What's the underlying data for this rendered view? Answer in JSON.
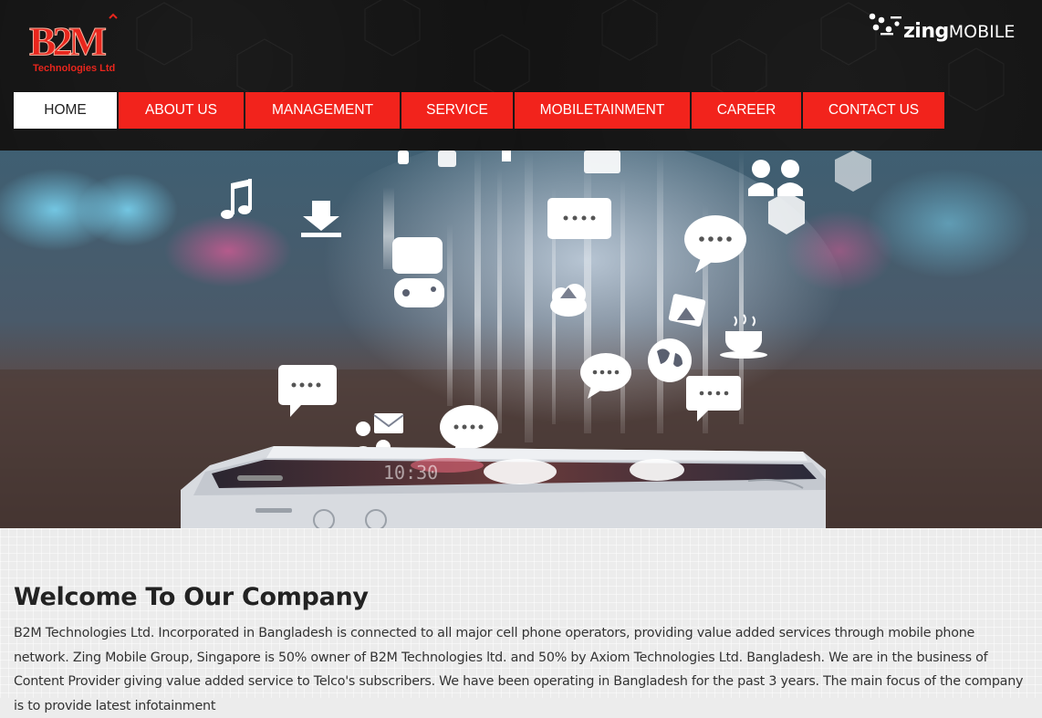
{
  "brand": {
    "logo_text": "B2M",
    "logo_subtext": "Technologies Ltd",
    "partner_bold": "zing",
    "partner_rest": "MOBILE"
  },
  "nav": [
    {
      "label": "HOME",
      "active": true
    },
    {
      "label": "ABOUT US",
      "active": false
    },
    {
      "label": "MANAGEMENT",
      "active": false
    },
    {
      "label": "SERVICE",
      "active": false
    },
    {
      "label": "MOBILETAINMENT",
      "active": false
    },
    {
      "label": "CAREER",
      "active": false
    },
    {
      "label": "CONTACT US",
      "active": false
    }
  ],
  "hero": {
    "phone_time": "10:30",
    "icons": [
      "music-note-icon",
      "download-icon",
      "game-controller-icon",
      "chat-bubble-icon",
      "cloud-upload-icon",
      "photo-icon",
      "coffee-cup-icon",
      "globe-icon",
      "people-icon",
      "email-icon",
      "hexagon-icon"
    ]
  },
  "main": {
    "title": "Welcome To Our Company",
    "intro": "B2M Technologies Ltd. Incorporated in Bangladesh is connected to all major cell phone operators, providing value added services through mobile phone network. Zing Mobile Group, Singapore is 50% owner of B2M Technologies ltd. and 50% by Axiom Technologies Ltd. Bangladesh. We are in the business of Content Provider giving value added service to Telco's subscribers. We have been operating in Bangladesh for the past 3 years. The main focus of the company is to provide latest infotainment"
  },
  "colors": {
    "accent": "#f2231c",
    "header_bg": "#121212",
    "content_bg": "#ececec"
  }
}
